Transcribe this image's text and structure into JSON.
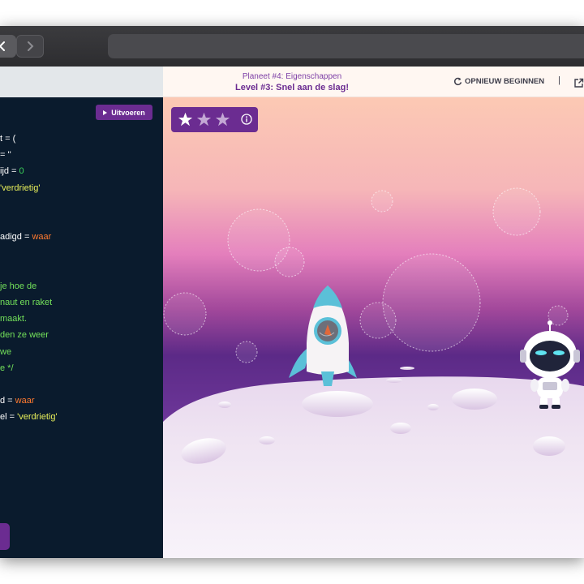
{
  "browser": {
    "back_icon": "chevron-left-icon",
    "forward_icon": "chevron-right-icon"
  },
  "editor": {
    "run_label": "Uitvoeren",
    "lines": [
      [
        {
          "t": "t = (",
          "c": "white"
        }
      ],
      [
        {
          "t": "= ''",
          "c": "white"
        }
      ],
      [
        {
          "t": "ijd = ",
          "c": "white"
        },
        {
          "t": "0",
          "c": "green"
        }
      ],
      [
        {
          "t": "'verdrietig'",
          "c": "yellow"
        }
      ],
      [
        {
          "t": "",
          "c": "white"
        }
      ],
      [
        {
          "t": "",
          "c": "white"
        }
      ],
      [
        {
          "t": "adigd = ",
          "c": "white"
        },
        {
          "t": "waar",
          "c": "orange"
        }
      ],
      [
        {
          "t": "",
          "c": "white"
        }
      ],
      [
        {
          "t": "",
          "c": "white"
        }
      ],
      [
        {
          "t": "je hoe de",
          "c": "comment"
        }
      ],
      [
        {
          "t": "naut en raket",
          "c": "comment"
        }
      ],
      [
        {
          "t": "maakt.",
          "c": "comment"
        }
      ],
      [
        {
          "t": "den ze weer",
          "c": "comment"
        }
      ],
      [
        {
          "t": "we",
          "c": "comment"
        }
      ],
      [
        {
          "t": "e */",
          "c": "comment"
        }
      ],
      [
        {
          "t": "",
          "c": "white"
        }
      ],
      [
        {
          "t": "d = ",
          "c": "white"
        },
        {
          "t": "waar",
          "c": "orange"
        }
      ],
      [
        {
          "t": "el = ",
          "c": "white"
        },
        {
          "t": "'verdrietig'",
          "c": "yellow"
        }
      ]
    ]
  },
  "header": {
    "planet": "Planeet #4: Eigenschappen",
    "level": "Level #3: Snel aan de slag!",
    "restart_label": "OPNIEUW BEGINNEN",
    "separator": "|",
    "restart_icon": "refresh-icon",
    "external_icon": "external-link-icon"
  },
  "game": {
    "stars_total": 3,
    "stars_earned": 0,
    "info_icon": "info-icon"
  },
  "colors": {
    "accent": "#6b2c91",
    "editor_bg": "#0a1b2d",
    "sky_top": "#fcc9b4",
    "sky_mid": "#e27cba",
    "sky_low": "#5b2a86"
  }
}
